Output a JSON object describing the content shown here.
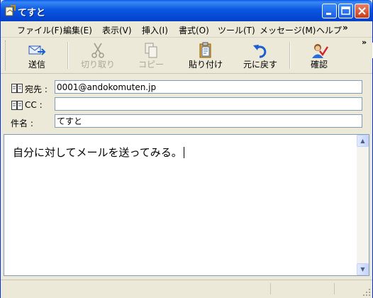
{
  "window": {
    "title": "てすと"
  },
  "menu": {
    "items": [
      "ファイル(F)",
      "編集(E)",
      "表示(V)",
      "挿入(I)",
      "書式(O)",
      "ツール(T)",
      "メッセージ(M)",
      "ヘルプ"
    ],
    "overflow": "»"
  },
  "toolbar": {
    "buttons": [
      {
        "label": "送信",
        "icon": "send-icon",
        "enabled": true
      },
      {
        "label": "切り取り",
        "icon": "scissors-icon",
        "enabled": false
      },
      {
        "label": "コピー",
        "icon": "copy-icon",
        "enabled": false
      },
      {
        "label": "貼り付け",
        "icon": "paste-icon",
        "enabled": true
      },
      {
        "label": "元に戻す",
        "icon": "undo-icon",
        "enabled": true
      },
      {
        "label": "確認",
        "icon": "check-names-icon",
        "enabled": true
      }
    ],
    "overflow": "»"
  },
  "headers": {
    "to_label": "宛先 :",
    "to_value": "0001@andokomuten.jp",
    "cc_label": "CC :",
    "cc_value": "",
    "subject_label": "件名 :",
    "subject_value": "てすと"
  },
  "body": {
    "text": "自分に対してメールを送ってみる。"
  },
  "colors": {
    "title_bar": "#0a5ae8",
    "window_face": "#ece9d8",
    "input_border": "#7f9db9"
  }
}
